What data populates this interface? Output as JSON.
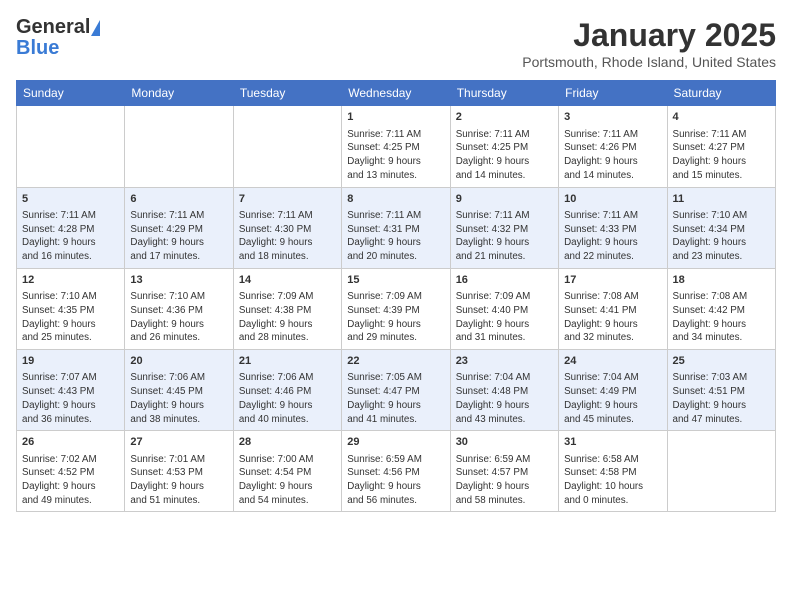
{
  "header": {
    "logo_general": "General",
    "logo_blue": "Blue",
    "month": "January 2025",
    "location": "Portsmouth, Rhode Island, United States"
  },
  "weekdays": [
    "Sunday",
    "Monday",
    "Tuesday",
    "Wednesday",
    "Thursday",
    "Friday",
    "Saturday"
  ],
  "weeks": [
    [
      {
        "day": "",
        "info": ""
      },
      {
        "day": "",
        "info": ""
      },
      {
        "day": "",
        "info": ""
      },
      {
        "day": "1",
        "info": "Sunrise: 7:11 AM\nSunset: 4:25 PM\nDaylight: 9 hours\nand 13 minutes."
      },
      {
        "day": "2",
        "info": "Sunrise: 7:11 AM\nSunset: 4:25 PM\nDaylight: 9 hours\nand 14 minutes."
      },
      {
        "day": "3",
        "info": "Sunrise: 7:11 AM\nSunset: 4:26 PM\nDaylight: 9 hours\nand 14 minutes."
      },
      {
        "day": "4",
        "info": "Sunrise: 7:11 AM\nSunset: 4:27 PM\nDaylight: 9 hours\nand 15 minutes."
      }
    ],
    [
      {
        "day": "5",
        "info": "Sunrise: 7:11 AM\nSunset: 4:28 PM\nDaylight: 9 hours\nand 16 minutes."
      },
      {
        "day": "6",
        "info": "Sunrise: 7:11 AM\nSunset: 4:29 PM\nDaylight: 9 hours\nand 17 minutes."
      },
      {
        "day": "7",
        "info": "Sunrise: 7:11 AM\nSunset: 4:30 PM\nDaylight: 9 hours\nand 18 minutes."
      },
      {
        "day": "8",
        "info": "Sunrise: 7:11 AM\nSunset: 4:31 PM\nDaylight: 9 hours\nand 20 minutes."
      },
      {
        "day": "9",
        "info": "Sunrise: 7:11 AM\nSunset: 4:32 PM\nDaylight: 9 hours\nand 21 minutes."
      },
      {
        "day": "10",
        "info": "Sunrise: 7:11 AM\nSunset: 4:33 PM\nDaylight: 9 hours\nand 22 minutes."
      },
      {
        "day": "11",
        "info": "Sunrise: 7:10 AM\nSunset: 4:34 PM\nDaylight: 9 hours\nand 23 minutes."
      }
    ],
    [
      {
        "day": "12",
        "info": "Sunrise: 7:10 AM\nSunset: 4:35 PM\nDaylight: 9 hours\nand 25 minutes."
      },
      {
        "day": "13",
        "info": "Sunrise: 7:10 AM\nSunset: 4:36 PM\nDaylight: 9 hours\nand 26 minutes."
      },
      {
        "day": "14",
        "info": "Sunrise: 7:09 AM\nSunset: 4:38 PM\nDaylight: 9 hours\nand 28 minutes."
      },
      {
        "day": "15",
        "info": "Sunrise: 7:09 AM\nSunset: 4:39 PM\nDaylight: 9 hours\nand 29 minutes."
      },
      {
        "day": "16",
        "info": "Sunrise: 7:09 AM\nSunset: 4:40 PM\nDaylight: 9 hours\nand 31 minutes."
      },
      {
        "day": "17",
        "info": "Sunrise: 7:08 AM\nSunset: 4:41 PM\nDaylight: 9 hours\nand 32 minutes."
      },
      {
        "day": "18",
        "info": "Sunrise: 7:08 AM\nSunset: 4:42 PM\nDaylight: 9 hours\nand 34 minutes."
      }
    ],
    [
      {
        "day": "19",
        "info": "Sunrise: 7:07 AM\nSunset: 4:43 PM\nDaylight: 9 hours\nand 36 minutes."
      },
      {
        "day": "20",
        "info": "Sunrise: 7:06 AM\nSunset: 4:45 PM\nDaylight: 9 hours\nand 38 minutes."
      },
      {
        "day": "21",
        "info": "Sunrise: 7:06 AM\nSunset: 4:46 PM\nDaylight: 9 hours\nand 40 minutes."
      },
      {
        "day": "22",
        "info": "Sunrise: 7:05 AM\nSunset: 4:47 PM\nDaylight: 9 hours\nand 41 minutes."
      },
      {
        "day": "23",
        "info": "Sunrise: 7:04 AM\nSunset: 4:48 PM\nDaylight: 9 hours\nand 43 minutes."
      },
      {
        "day": "24",
        "info": "Sunrise: 7:04 AM\nSunset: 4:49 PM\nDaylight: 9 hours\nand 45 minutes."
      },
      {
        "day": "25",
        "info": "Sunrise: 7:03 AM\nSunset: 4:51 PM\nDaylight: 9 hours\nand 47 minutes."
      }
    ],
    [
      {
        "day": "26",
        "info": "Sunrise: 7:02 AM\nSunset: 4:52 PM\nDaylight: 9 hours\nand 49 minutes."
      },
      {
        "day": "27",
        "info": "Sunrise: 7:01 AM\nSunset: 4:53 PM\nDaylight: 9 hours\nand 51 minutes."
      },
      {
        "day": "28",
        "info": "Sunrise: 7:00 AM\nSunset: 4:54 PM\nDaylight: 9 hours\nand 54 minutes."
      },
      {
        "day": "29",
        "info": "Sunrise: 6:59 AM\nSunset: 4:56 PM\nDaylight: 9 hours\nand 56 minutes."
      },
      {
        "day": "30",
        "info": "Sunrise: 6:59 AM\nSunset: 4:57 PM\nDaylight: 9 hours\nand 58 minutes."
      },
      {
        "day": "31",
        "info": "Sunrise: 6:58 AM\nSunset: 4:58 PM\nDaylight: 10 hours\nand 0 minutes."
      },
      {
        "day": "",
        "info": ""
      }
    ]
  ]
}
